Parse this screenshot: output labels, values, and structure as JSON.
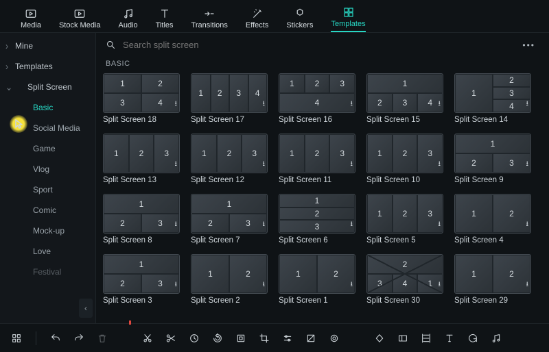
{
  "top_tabs": {
    "media": "Media",
    "stock": "Stock Media",
    "audio": "Audio",
    "titles": "Titles",
    "transitions": "Transitions",
    "effects": "Effects",
    "stickers": "Stickers",
    "templates": "Templates"
  },
  "sidebar": {
    "mine": "Mine",
    "templates": "Templates",
    "split": "Split Screen",
    "subs": {
      "basic": "Basic",
      "social": "Social Media",
      "game": "Game",
      "vlog": "Vlog",
      "sport": "Sport",
      "comic": "Comic",
      "mockup": "Mock-up",
      "love": "Love",
      "festival": "Festival"
    }
  },
  "search": {
    "placeholder": "Search split screen"
  },
  "section": "BASIC",
  "cards": [
    {
      "id": "c0",
      "title": "Split Screen 18",
      "layout": "g2x2",
      "nums": [
        "1",
        "2",
        "3",
        "4"
      ]
    },
    {
      "id": "c1",
      "title": "Split Screen 17",
      "layout": "g1x4",
      "nums": [
        "1",
        "2",
        "3",
        "4"
      ]
    },
    {
      "id": "c2",
      "title": "Split Screen 16",
      "layout": "g3top1bot",
      "nums": [
        "1",
        "2",
        "3",
        "4"
      ]
    },
    {
      "id": "c3",
      "title": "Split Screen 15",
      "layout": "g1top3bot",
      "nums": [
        "1",
        "2",
        "3",
        "4"
      ]
    },
    {
      "id": "c4",
      "title": "Split Screen 14",
      "layout": "g1left3right",
      "nums": [
        "1",
        "2",
        "3",
        "4"
      ]
    },
    {
      "id": "c5",
      "title": "Split Screen 13",
      "layout": "g1x3",
      "nums": [
        "1",
        "2",
        "3"
      ]
    },
    {
      "id": "c6",
      "title": "Split Screen 12",
      "layout": "g1x3",
      "nums": [
        "1",
        "2",
        "3"
      ]
    },
    {
      "id": "c7",
      "title": "Split Screen 11",
      "layout": "g1x3",
      "nums": [
        "1",
        "2",
        "3"
      ]
    },
    {
      "id": "c8",
      "title": "Split Screen 10",
      "layout": "g1x3",
      "nums": [
        "1",
        "2",
        "3"
      ]
    },
    {
      "id": "c9",
      "title": "Split Screen 9",
      "layout": "g1top2bot",
      "nums": [
        "1",
        "2",
        "3"
      ]
    },
    {
      "id": "c10",
      "title": "Split Screen 8",
      "layout": "g1top2bot",
      "nums": [
        "1",
        "2",
        "3"
      ]
    },
    {
      "id": "c11",
      "title": "Split Screen 7",
      "layout": "g1top2bot",
      "nums": [
        "1",
        "2",
        "3"
      ]
    },
    {
      "id": "c12",
      "title": "Split Screen 6",
      "layout": "g3x1",
      "nums": [
        "1",
        "2",
        "3"
      ]
    },
    {
      "id": "c13",
      "title": "Split Screen 5",
      "layout": "g1x3",
      "nums": [
        "1",
        "2",
        "3"
      ]
    },
    {
      "id": "c14",
      "title": "Split Screen 4",
      "layout": "g1x2",
      "nums": [
        "1",
        "2"
      ]
    },
    {
      "id": "c15",
      "title": "Split Screen 3",
      "layout": "g1top2bot",
      "nums": [
        "1",
        "2",
        "3"
      ]
    },
    {
      "id": "c16",
      "title": "Split Screen 2",
      "layout": "g1x2",
      "nums": [
        "1",
        "2"
      ]
    },
    {
      "id": "c17",
      "title": "Split Screen 1",
      "layout": "g1x2",
      "nums": [
        "1",
        "2"
      ]
    },
    {
      "id": "c18",
      "title": "Split Screen 30",
      "layout": "diag",
      "nums": [
        "1",
        "2",
        "3",
        "4"
      ]
    },
    {
      "id": "c19",
      "title": "Split Screen 29",
      "layout": "g1x2",
      "nums": [
        "1",
        "2"
      ]
    }
  ]
}
